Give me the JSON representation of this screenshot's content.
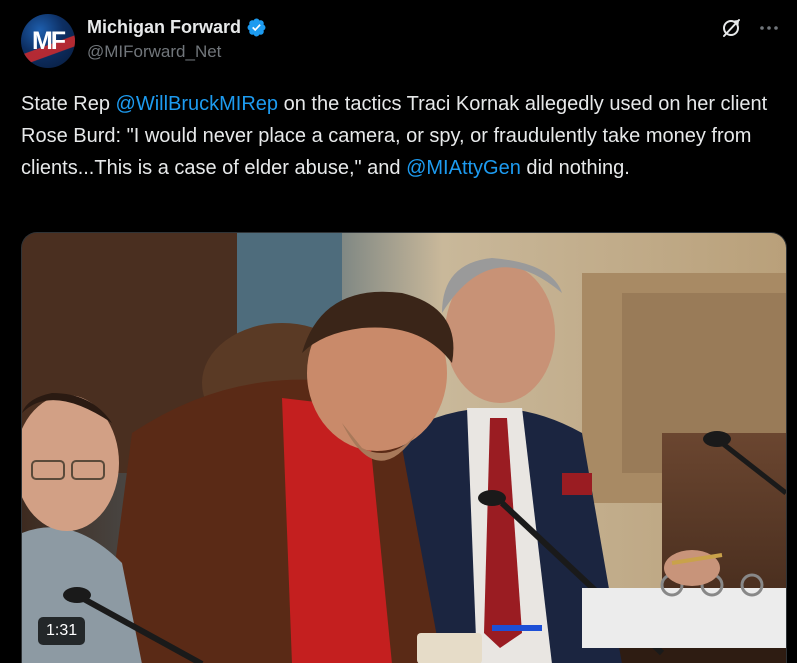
{
  "author": {
    "display_name": "Michigan Forward",
    "handle": "@MIForward_Net",
    "avatar_initials": "MF",
    "verified": true
  },
  "icons": {
    "verified": "verified-badge-icon",
    "grok": "grok-icon",
    "more": "more-icon"
  },
  "tweet": {
    "text_1": "State Rep ",
    "mention_1": "@WillBruckMIRep",
    "text_2": " on the tactics Traci Kornak allegedly used on her client Rose Burd: \"I would never place a camera, or spy, or fraudulently take money from clients...This is a case of elder abuse,\" and ",
    "mention_2": "@MIAttyGen",
    "text_3": " did nothing."
  },
  "media": {
    "type": "video",
    "duration": "1:31"
  },
  "colors": {
    "background": "#000000",
    "text": "#e7e9ea",
    "secondary": "#71767b",
    "accent": "#1d9bf0"
  }
}
